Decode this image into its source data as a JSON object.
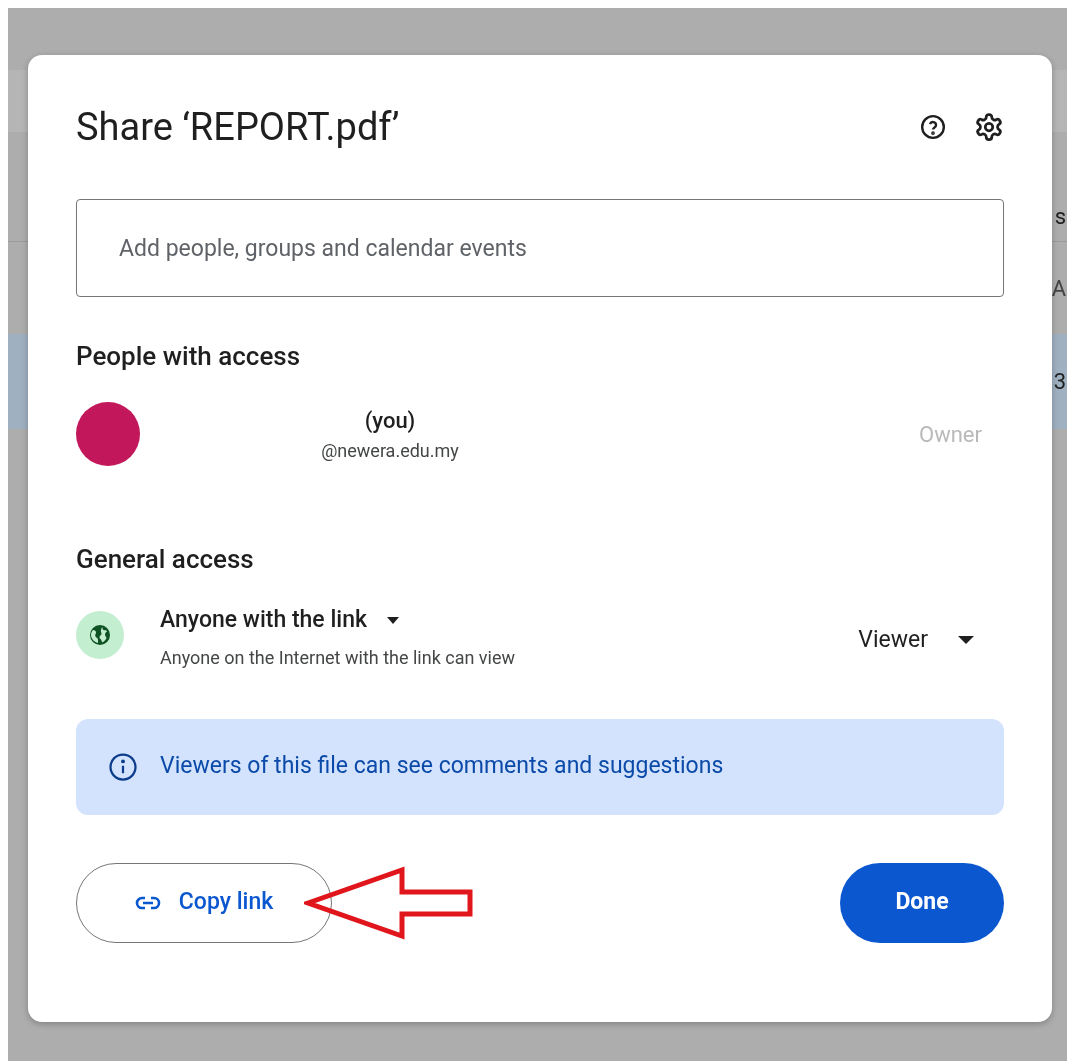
{
  "background": {
    "fragments": [
      "s",
      "A",
      "3"
    ]
  },
  "dialog": {
    "title": "Share ‘REPORT.pdf’",
    "search": {
      "placeholder": "Add people, groups and calendar events"
    },
    "people_section": {
      "title": "People with access",
      "people": [
        {
          "name": "(you)",
          "email": "@newera.edu.my",
          "role": "Owner",
          "role_disabled": true
        }
      ]
    },
    "general_access": {
      "title": "General access",
      "scope": "Anyone with the link",
      "description": "Anyone on the Internet with the link can view",
      "role": "Viewer"
    },
    "info_banner": "Viewers of this file can see comments and suggestions",
    "buttons": {
      "copy_link": "Copy link",
      "done": "Done"
    }
  }
}
